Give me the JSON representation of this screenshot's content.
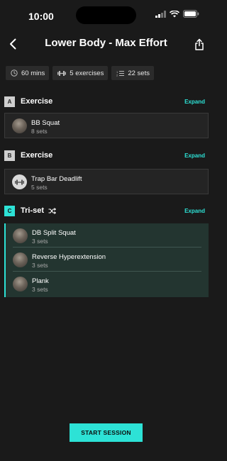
{
  "status": {
    "time": "10:00"
  },
  "header": {
    "title": "Lower Body - Max Effort"
  },
  "chips": [
    {
      "icon": "clock-icon",
      "label": "60 mins"
    },
    {
      "icon": "dumbbell-icon",
      "label": "5 exercises"
    },
    {
      "icon": "list-icon",
      "label": "22 sets"
    }
  ],
  "sections": [
    {
      "letter": "A",
      "title": "Exercise",
      "expand": "Expand",
      "items": [
        {
          "name": "BB Squat",
          "sets": "8 sets"
        }
      ]
    },
    {
      "letter": "B",
      "title": "Exercise",
      "expand": "Expand",
      "items": [
        {
          "name": "Trap Bar Deadlift",
          "sets": "5 sets"
        }
      ]
    },
    {
      "letter": "C",
      "title": "Tri-set",
      "expand": "Expand",
      "items": [
        {
          "name": "DB Split Squat",
          "sets": "3 sets"
        },
        {
          "name": "Reverse Hyperextension",
          "sets": "3 sets"
        },
        {
          "name": "Plank",
          "sets": "3 sets"
        }
      ]
    }
  ],
  "actions": {
    "start_label": "START SESSION"
  },
  "colors": {
    "accent": "#2de2d6",
    "background": "#1a1a1a",
    "triset_bg": "#233530"
  }
}
